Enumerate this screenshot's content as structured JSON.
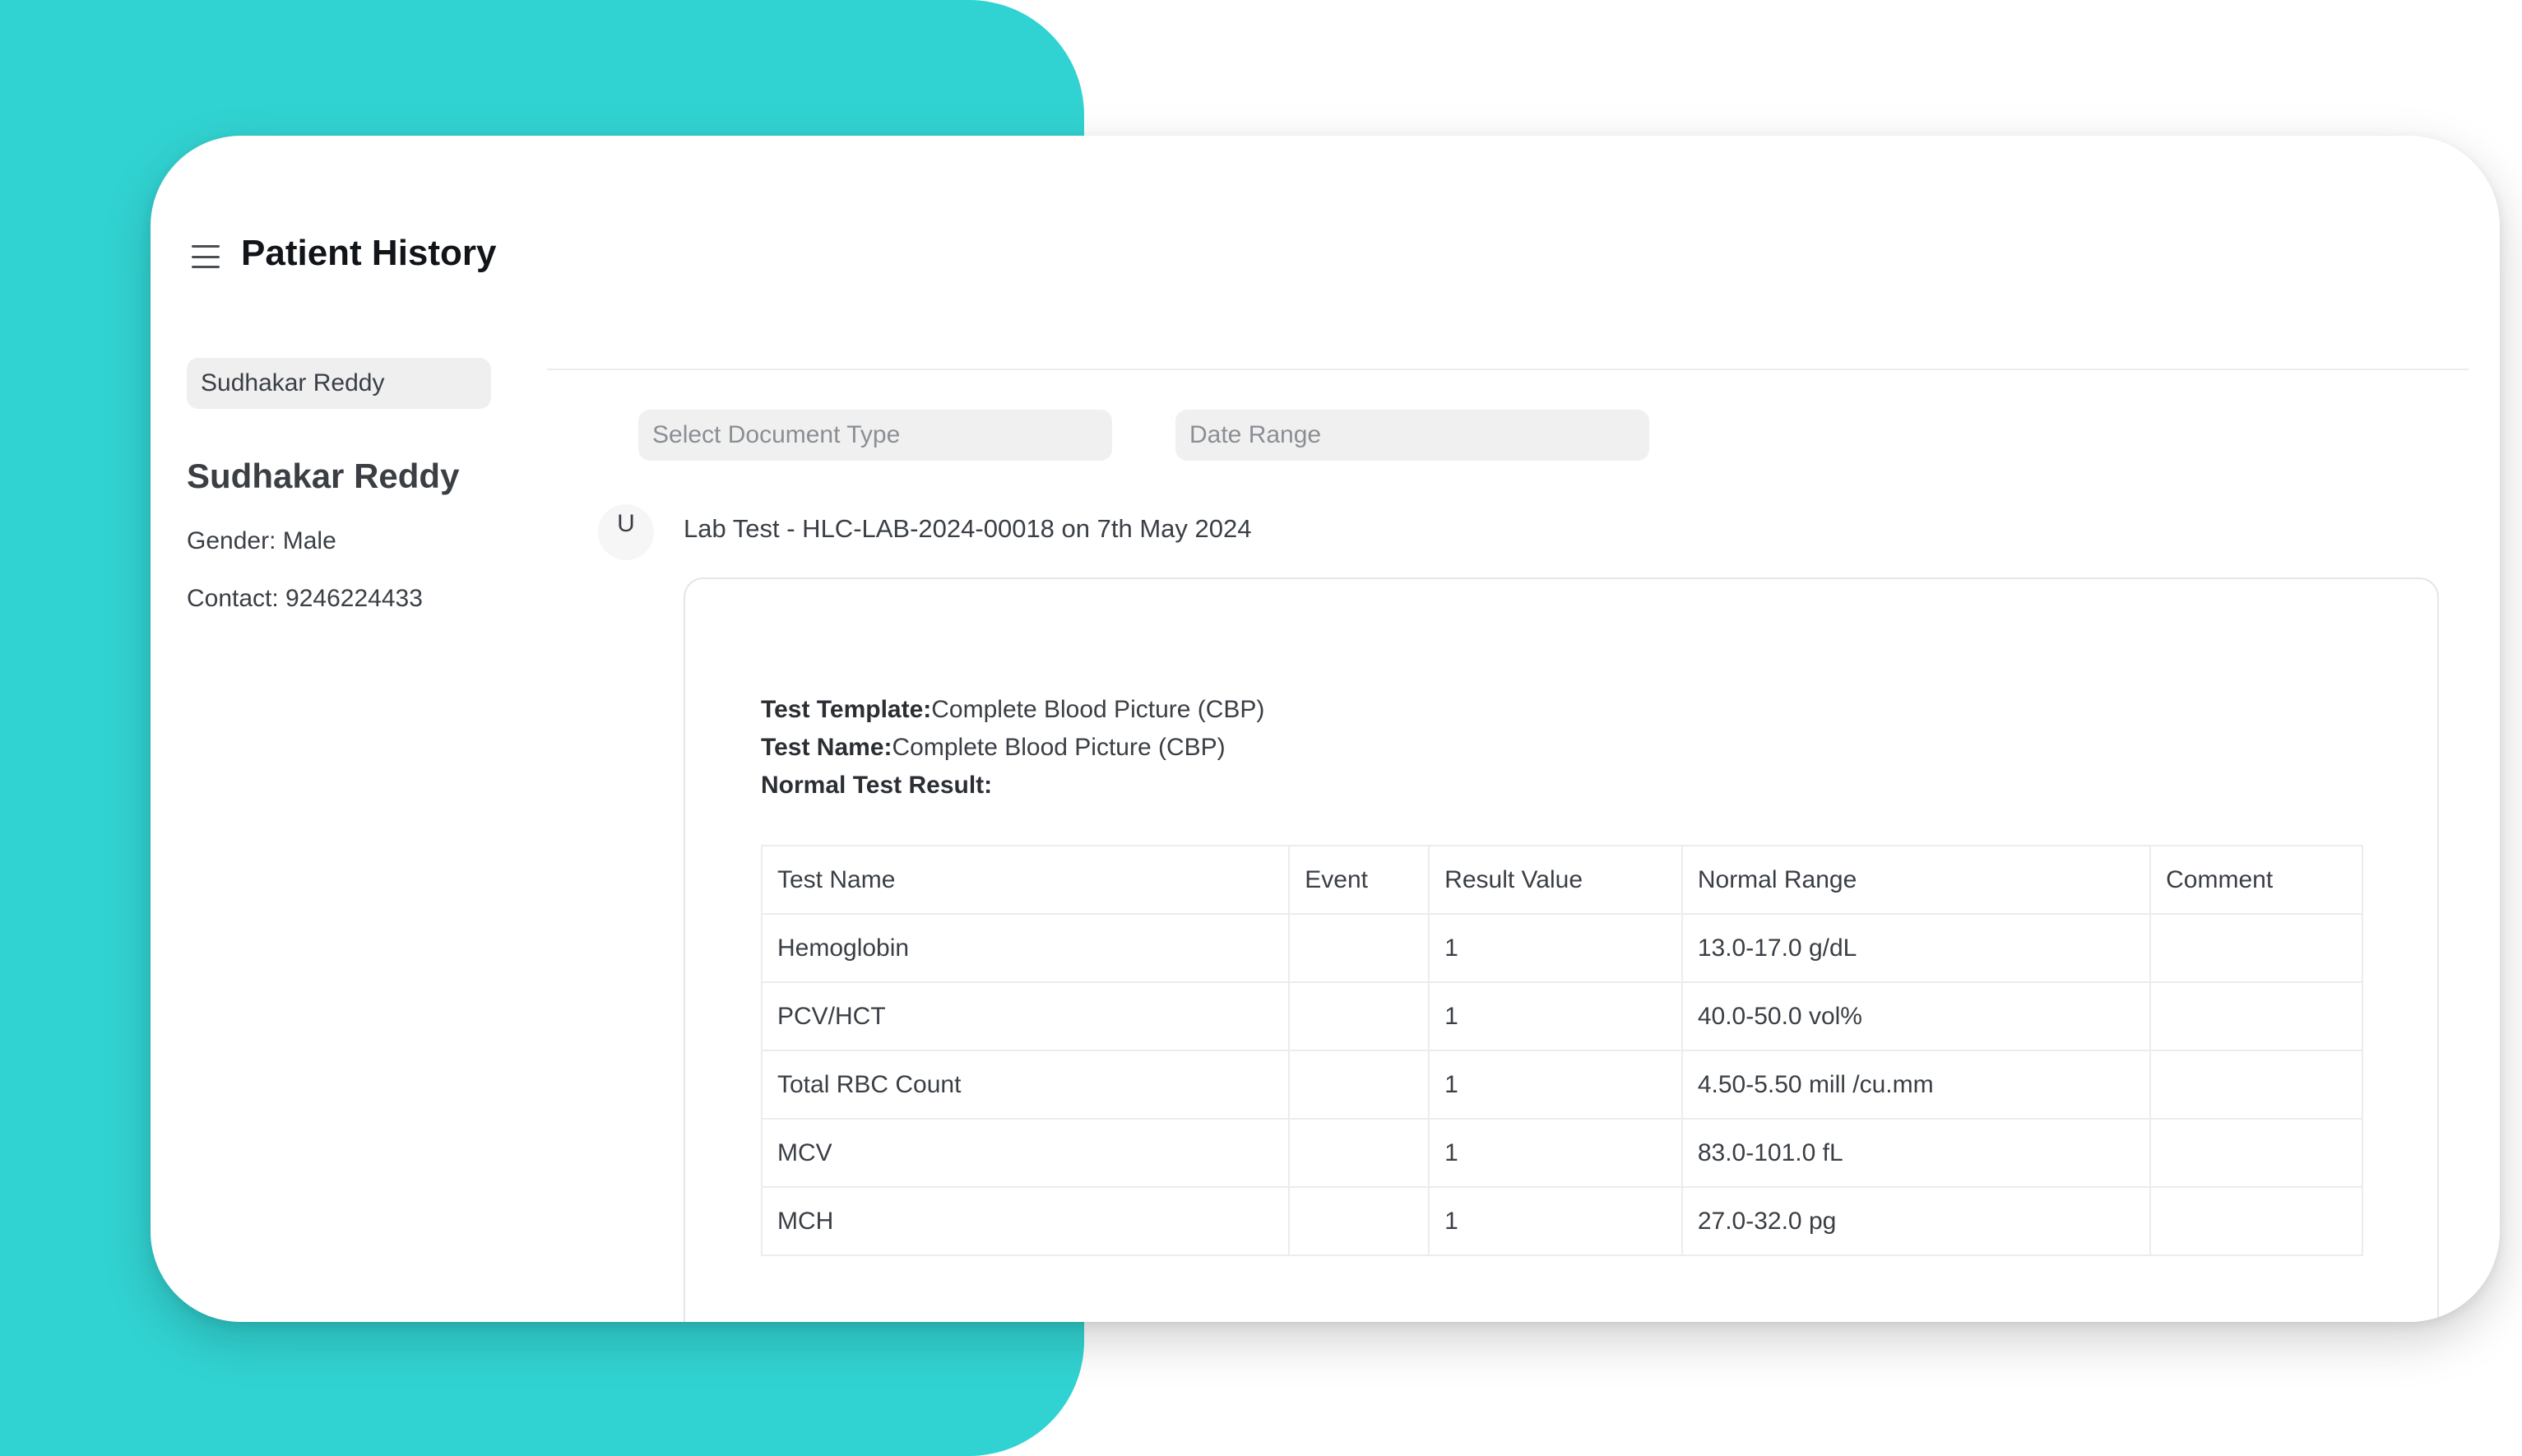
{
  "header": {
    "title": "Patient History"
  },
  "sidebar": {
    "patient_selector_value": "Sudhakar Reddy",
    "patient_name": "Sudhakar Reddy",
    "gender": "Gender: Male",
    "contact": "Contact: 9246224433"
  },
  "filters": {
    "document_type_placeholder": "Select Document Type",
    "date_range_placeholder": "Date Range"
  },
  "timeline": {
    "avatar_letter": "U",
    "entry_title": "Lab Test - HLC-LAB-2024-00018 on 7th May 2024"
  },
  "lab_doc": {
    "template_label": "Test Template:",
    "template_value": "Complete Blood Picture (CBP)",
    "name_label": "Test Name:",
    "name_value": "Complete Blood Picture (CBP)",
    "normal_result_label": "Normal Test Result:",
    "columns": [
      "Test Name",
      "Event",
      "Result Value",
      "Normal Range",
      "Comment"
    ],
    "rows": [
      [
        "Hemoglobin",
        "",
        "1",
        "13.0-17.0 g/dL",
        ""
      ],
      [
        "PCV/HCT",
        "",
        "1",
        "40.0-50.0 vol%",
        ""
      ],
      [
        "Total RBC Count",
        "",
        "1",
        "4.50-5.50 mill /cu.mm",
        ""
      ],
      [
        "MCV",
        "",
        "1",
        "83.0-101.0 fL",
        ""
      ],
      [
        "MCH",
        "",
        "1",
        "27.0-32.0 pg",
        ""
      ]
    ]
  },
  "colors": {
    "accent_teal": "#31d3d2",
    "card_bg": "#ffffff"
  }
}
